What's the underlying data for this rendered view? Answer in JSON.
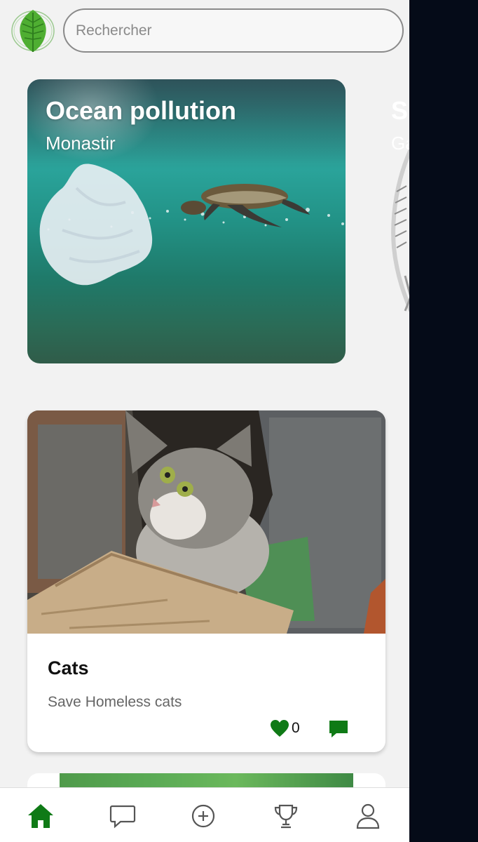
{
  "search": {
    "placeholder": "Rechercher"
  },
  "featured": [
    {
      "title": "Ocean pollution",
      "subtitle": "Monastir"
    },
    {
      "title": "S",
      "subtitle": "Ga"
    }
  ],
  "posts": [
    {
      "title": "Cats",
      "description": "Save Homeless cats",
      "likes": "0"
    }
  ],
  "nav": [
    "home",
    "messages",
    "add",
    "trophy",
    "profile"
  ],
  "colors": {
    "accent": "#0f7a16",
    "background": "#f2f2f2",
    "side_panel": "#050b18"
  }
}
